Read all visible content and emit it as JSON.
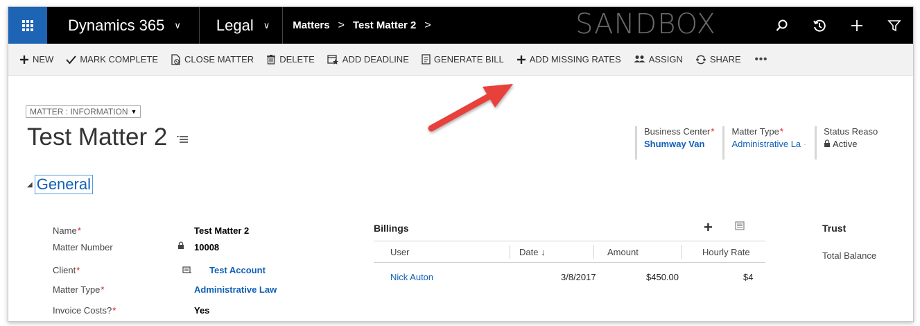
{
  "nav": {
    "brand": "Dynamics 365",
    "app": "Legal",
    "breadcrumb": [
      "Matters",
      "Test Matter 2"
    ],
    "environment": "SANDBOX",
    "icons": [
      "search-icon",
      "recent-icon",
      "new-icon",
      "filter-icon"
    ]
  },
  "commands": [
    {
      "label": "NEW",
      "icon": "plus-icon"
    },
    {
      "label": "MARK COMPLETE",
      "icon": "check-icon"
    },
    {
      "label": "CLOSE MATTER",
      "icon": "close-document-icon"
    },
    {
      "label": "DELETE",
      "icon": "trash-icon"
    },
    {
      "label": "ADD DEADLINE",
      "icon": "calendar-star-icon"
    },
    {
      "label": "GENERATE BILL",
      "icon": "bill-icon"
    },
    {
      "label": "ADD MISSING RATES",
      "icon": "plus-icon"
    },
    {
      "label": "ASSIGN",
      "icon": "people-icon"
    },
    {
      "label": "SHARE",
      "icon": "share-icon"
    },
    {
      "label": "•••",
      "icon": "more-icon"
    }
  ],
  "form": {
    "selector": "MATTER : INFORMATION",
    "title": "Test Matter 2"
  },
  "header_fields": [
    {
      "label": "Business Center",
      "required": true,
      "value": "Shumway Van"
    },
    {
      "label": "Matter Type",
      "required": true,
      "value": "Administrative La"
    },
    {
      "label": "Status Reaso",
      "required": false,
      "value": "Active"
    }
  ],
  "section": {
    "title": "General"
  },
  "fields": [
    {
      "label": "Name",
      "required": true,
      "value": "Test Matter 2"
    },
    {
      "label": "Matter Number",
      "required": false,
      "value": "10008"
    },
    {
      "label": "Client",
      "required": true,
      "value": "Test Account"
    },
    {
      "label": "Matter Type",
      "required": true,
      "value": "Administrative Law"
    },
    {
      "label": "Invoice Costs?",
      "required": true,
      "value": "Yes"
    }
  ],
  "billings": {
    "title": "Billings",
    "add": "+",
    "columns": [
      "User",
      "Date ↓",
      "Amount",
      "Hourly Rate"
    ],
    "rows": [
      {
        "user": "Nick Auton",
        "date": "3/8/2017",
        "amount": "$450.00",
        "rate": "$4"
      }
    ]
  },
  "trust": {
    "title": "Trust",
    "total_balance_label": "Total Balance"
  },
  "colors": {
    "nav_bg": "#000000",
    "waffle_bg": "#1e64b4",
    "link": "#1160b7",
    "required": "#e81123",
    "arrow": "#e8403a"
  }
}
